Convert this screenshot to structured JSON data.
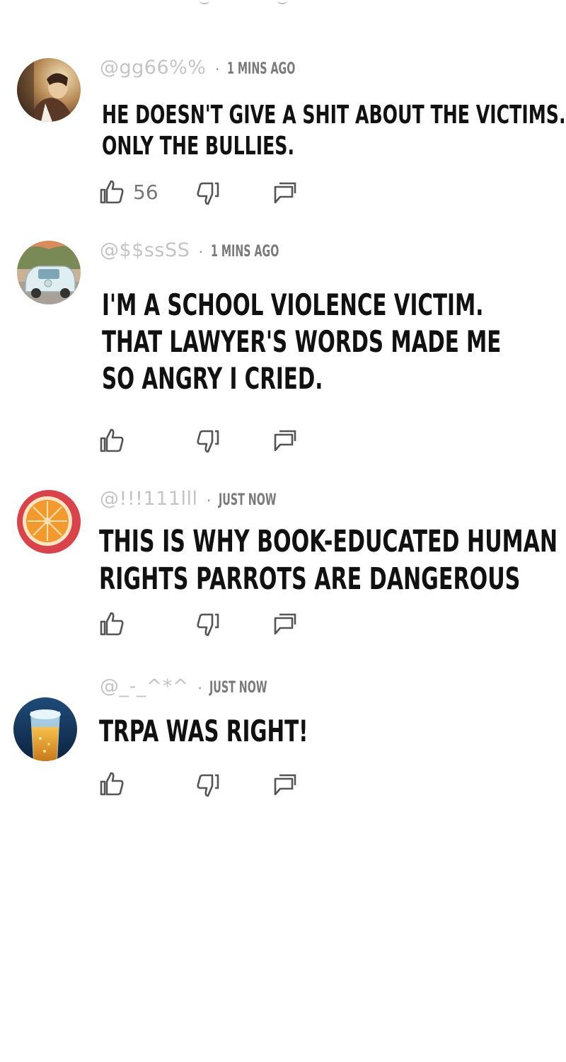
{
  "comments": [
    {
      "username": "@gg66%%",
      "time": "1 MINS AGO",
      "lines": [
        "HE DOESN'T GIVE A SHIT ABOUT THE VICTIMS.",
        "ONLY THE BULLIES."
      ],
      "likes": "56",
      "avatar": "person-portrait-avatar"
    },
    {
      "username": "@$$ssSS",
      "time": "1 MINS AGO",
      "lines": [
        "I'M A SCHOOL VIOLENCE VICTIM.",
        "THAT LAWYER'S WORDS MADE ME",
        "SO ANGRY I CRIED."
      ],
      "likes": "",
      "avatar": "car-avatar"
    },
    {
      "username": "@!!!111lll",
      "time": "JUST NOW",
      "lines": [
        "THIS IS WHY BOOK-EDUCATED HUMAN",
        "RIGHTS PARROTS ARE DANGEROUS"
      ],
      "likes": "",
      "avatar": "orange-slice-avatar"
    },
    {
      "username": "@_-_^*^",
      "time": "JUST NOW",
      "lines": [
        "TRPA WAS RIGHT!"
      ],
      "likes": "",
      "avatar": "beer-glass-avatar"
    }
  ],
  "icons": {
    "like": "thumbs-up-icon",
    "dislike": "thumbs-down-icon",
    "reply": "reply-icon"
  },
  "colors": {
    "username": "#c4c4c4",
    "time": "#7a7a7a",
    "text": "#111111",
    "icon": "#555555"
  }
}
